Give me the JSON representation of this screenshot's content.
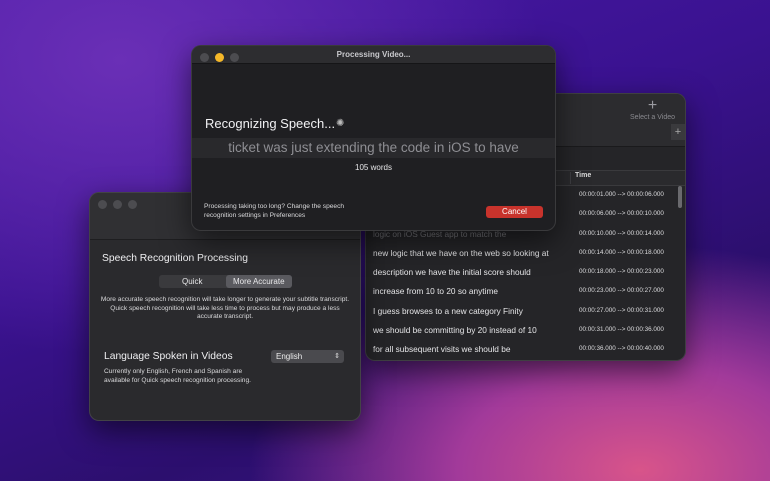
{
  "transcript_window": {
    "add_video_label": "Select a Video",
    "add_tab_symbol": "+",
    "time_header": "Time",
    "rows": [
      {
        "text": "",
        "time": "00:00:01.000 --> 00:00:06.000"
      },
      {
        "text": "",
        "time": "00:00:06.000 --> 00:00:10.000"
      },
      {
        "text": "logic on iOS Guest app to match the",
        "time": "00:00:10.000 --> 00:00:14.000"
      },
      {
        "text": "new logic that we have on the web so looking at",
        "time": "00:00:14.000 --> 00:00:18.000"
      },
      {
        "text": "description we have the initial score should",
        "time": "00:00:18.000 --> 00:00:23.000"
      },
      {
        "text": "increase from 10 to 20 so anytime",
        "time": "00:00:23.000 --> 00:00:27.000"
      },
      {
        "text": "I guess browses to a new category Finity",
        "time": "00:00:27.000 --> 00:00:31.000"
      },
      {
        "text": "we should be committing by 20 instead of 10",
        "time": "00:00:31.000 --> 00:00:36.000"
      },
      {
        "text": "for all subsequent visits we should be",
        "time": "00:00:36.000 --> 00:00:40.000"
      }
    ]
  },
  "preferences_window": {
    "speech_section_title": "Speech Recognition Processing",
    "segment_quick": "Quick",
    "segment_accurate": "More Accurate",
    "speech_description": "More accurate speech recognition will take longer to generate your subtitle transcript. Quick speech recognition will take less time to process but may produce a less accurate transcript.",
    "language_section_title": "Language Spoken in Videos",
    "language_value": "English",
    "language_description": "Currently only English, French and Spanish are available for Quick speech recognition processing."
  },
  "processing_dialog": {
    "title": "Processing Video...",
    "status": "Recognizing Speech...",
    "live_text": "ticket was just extending the code in iOS to have",
    "word_count": "105 words",
    "hint": "Processing taking too long? Change the speech recognition settings in Preferences",
    "cancel_label": "Cancel"
  }
}
